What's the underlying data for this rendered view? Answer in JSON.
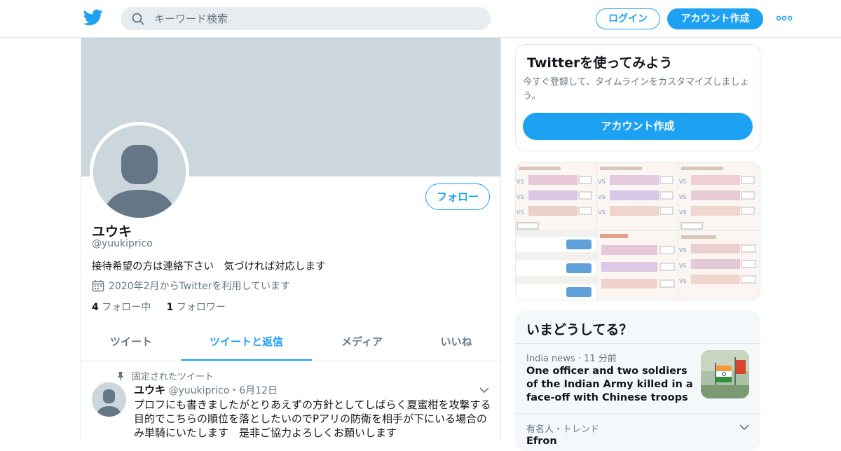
{
  "header": {
    "logo_icon": "twitter-bird-icon",
    "search_placeholder": "キーワード検索",
    "login_label": "ログイン",
    "signup_label": "アカウント作成",
    "more_icon": "more-dots-icon",
    "brand_color": "#1da1f2"
  },
  "profile": {
    "display_name": "ユウキ",
    "handle": "@yuukiprico",
    "bio": "接待希望の方は連絡下さい　気づければ対応します",
    "joined": "2020年2月からTwitterを利用しています",
    "follow_label": "フォロー",
    "following_count": "4",
    "following_label": "フォロー中",
    "followers_count": "1",
    "followers_label": "フォロワー"
  },
  "tabs": [
    {
      "label": "ツイート",
      "active": false
    },
    {
      "label": "ツイートと返信",
      "active": true
    },
    {
      "label": "メディア",
      "active": false
    },
    {
      "label": "いいね",
      "active": false
    }
  ],
  "pinned_tweet": {
    "pinned_label": "固定されたツイート",
    "name": "ユウキ",
    "handle": "@yuukiprico",
    "separator": "・",
    "date": "6月12日",
    "text": "プロフにも書きましたがとりあえずの方針としてしばらく夏蜜柑を攻撃する目的でこちらの順位を落としたいのでPアリの防衛を相手が下にいる場合のみ単騎にいたします　是非ご協力よろしくお願いします"
  },
  "signup_card": {
    "title": "Twitterを使ってみよう",
    "description": "今すぐ登録して、タイムラインをカスタマイズしましょう。",
    "button_label": "アカウント作成"
  },
  "trends": {
    "title": "いまどうしてる？",
    "items": [
      {
        "category": "India news",
        "time": "11 分前",
        "headline": "One officer and two soldiers of the Indian Army killed in a face-off with Chinese troops"
      },
      {
        "category": "有名人・トレンド",
        "headline": "Efron"
      }
    ]
  }
}
